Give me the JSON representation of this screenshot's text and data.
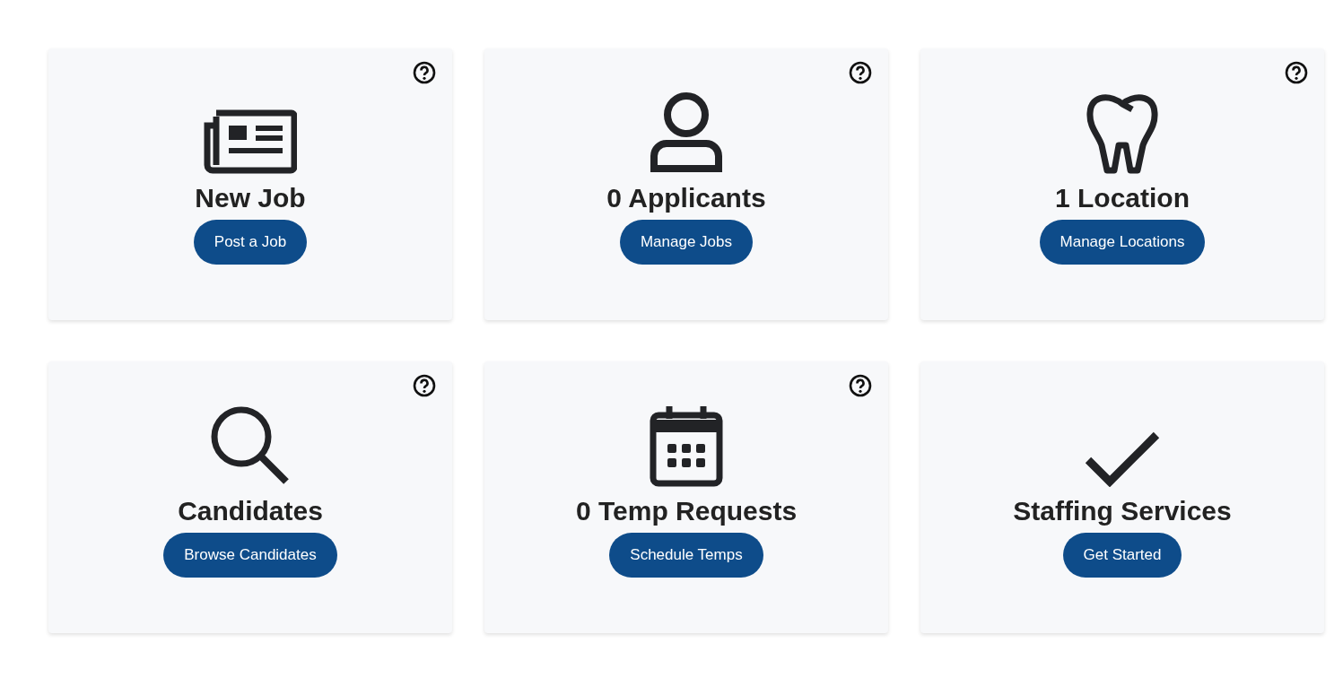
{
  "cards": [
    {
      "kind": "newspaper",
      "title": "New Job",
      "button": "Post a Job",
      "help": true
    },
    {
      "kind": "person",
      "title": "0 Applicants",
      "button": "Manage Jobs",
      "help": true
    },
    {
      "kind": "tooth",
      "title": "1 Location",
      "button": "Manage Locations",
      "help": true
    },
    {
      "kind": "search",
      "title": "Candidates",
      "button": "Browse Candidates",
      "help": true
    },
    {
      "kind": "calendar",
      "title": "0 Temp Requests",
      "button": "Schedule Temps",
      "help": true
    },
    {
      "kind": "check",
      "title": "Staffing Services",
      "button": "Get Started",
      "help": false
    }
  ]
}
